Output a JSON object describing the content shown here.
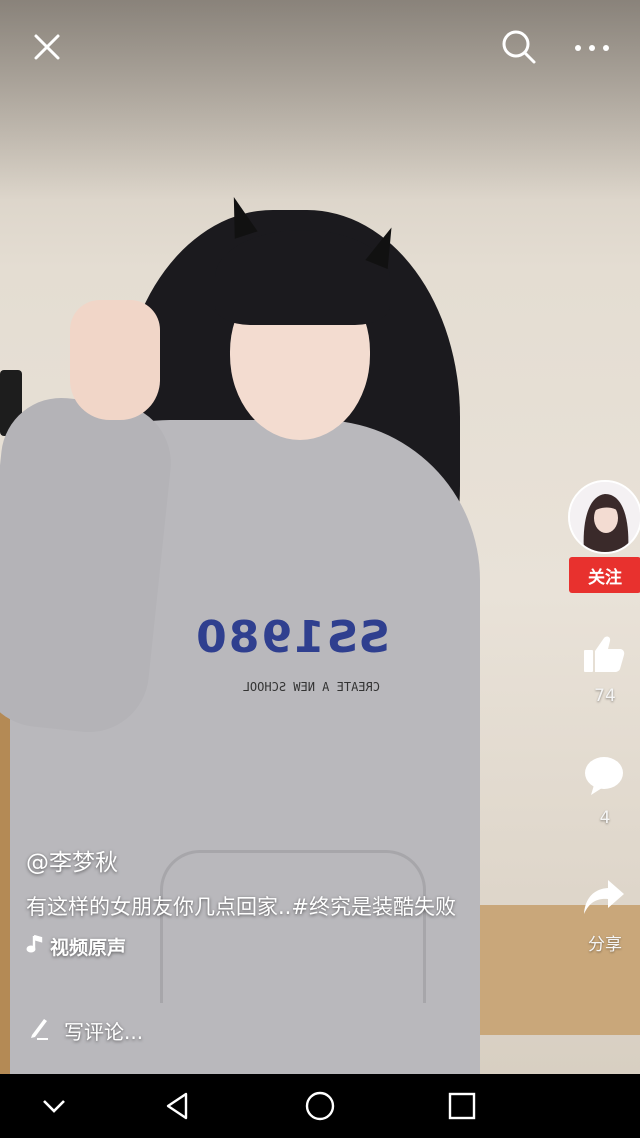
{
  "top_bar": {
    "close_icon": "close-icon",
    "search_icon": "search-icon",
    "more_icon": "more-options-icon"
  },
  "right_rail": {
    "follow_label": "关注",
    "like_count": "74",
    "comment_count": "4",
    "share_label": "分享",
    "accent_color": "#e8312e"
  },
  "caption": {
    "author": "@李梦秋",
    "description": "有这样的女朋友你几点回家..#终究是装酷失败",
    "music": "视频原声"
  },
  "comment_bar": {
    "placeholder": "写评论..."
  },
  "video": {
    "shirt_print": "SS1980",
    "shirt_print_sub": "CREATE A NEW SCHOOL"
  },
  "nav_bar": {
    "back_icon": "back-triangle-icon",
    "home_icon": "home-circle-icon",
    "recents_icon": "recents-square-icon",
    "collapse_icon": "chevron-down-icon"
  }
}
